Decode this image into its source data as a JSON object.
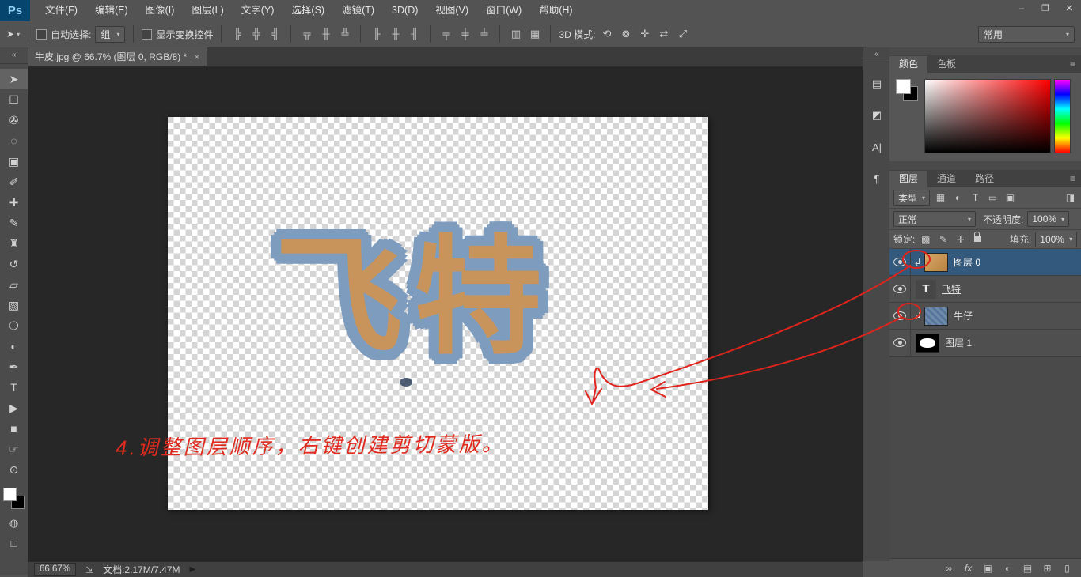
{
  "colors": {
    "selected_layer_blue": "#33597c",
    "denim_outline": "#7e9cbd",
    "leather_fill": "#c9945c",
    "annotation_red": "#e02a1e"
  },
  "window": {
    "minimize": "–",
    "restore": "❐",
    "close": "✕"
  },
  "menu_bar": {
    "logo": "Ps",
    "items": [
      "文件(F)",
      "编辑(E)",
      "图像(I)",
      "图层(L)",
      "文字(Y)",
      "选择(S)",
      "滤镜(T)",
      "3D(D)",
      "视图(V)",
      "窗口(W)",
      "帮助(H)"
    ]
  },
  "options_bar": {
    "tool_icon": "➤",
    "tool_dd": "▾",
    "auto_select_label": "自动选择:",
    "auto_select_value": "组",
    "dd_arrow": "▾",
    "show_transform_label": "显示变换控件",
    "align_icons": [
      "╠",
      "╬",
      "╣",
      "╦",
      "╫",
      "╩",
      "╟",
      "╫",
      "╢",
      "╤",
      "╪",
      "╧"
    ],
    "pair_icons": [
      "▥",
      "▦"
    ],
    "mode3d_label": "3D 模式:",
    "mode3d_icons": [
      "⟲",
      "⊚",
      "✛",
      "⇄",
      "⤢"
    ],
    "workspace": "常用"
  },
  "tab_bar": {
    "title": "牛皮.jpg @ 66.7% (图层 0, RGB/8) *",
    "close": "×"
  },
  "toolbar": {
    "collapse": "«",
    "tools": [
      {
        "id": "move",
        "glyph": "➤"
      },
      {
        "id": "marquee",
        "glyph": "☐"
      },
      {
        "id": "lasso",
        "glyph": "✇"
      },
      {
        "id": "quick-select",
        "glyph": "◌"
      },
      {
        "id": "crop",
        "glyph": "▣"
      },
      {
        "id": "eyedropper",
        "glyph": "✐"
      },
      {
        "id": "healing",
        "glyph": "✚"
      },
      {
        "id": "brush",
        "glyph": "✎"
      },
      {
        "id": "stamp",
        "glyph": "♜"
      },
      {
        "id": "history-brush",
        "glyph": "↺"
      },
      {
        "id": "eraser",
        "glyph": "▱"
      },
      {
        "id": "gradient",
        "glyph": "▧"
      },
      {
        "id": "blur",
        "glyph": "❍"
      },
      {
        "id": "dodge",
        "glyph": "◐"
      },
      {
        "id": "pen",
        "glyph": "✒"
      },
      {
        "id": "type",
        "glyph": "T"
      },
      {
        "id": "path-select",
        "glyph": "▶"
      },
      {
        "id": "shape",
        "glyph": "■"
      },
      {
        "id": "hand",
        "glyph": "☞"
      },
      {
        "id": "zoom",
        "glyph": "⊙"
      }
    ],
    "mask_icon": "◍",
    "screen_icon": "□"
  },
  "canvas": {
    "artwork_text": "飞特",
    "annotation": "4.调整图层顺序，右键创建剪切蒙版。"
  },
  "dock": {
    "collapse": "«",
    "icons": [
      "▤",
      "◩",
      "A|",
      "¶"
    ]
  },
  "color_panel": {
    "tabs": [
      "颜色",
      "色板"
    ],
    "menu_icon": "≡"
  },
  "layers_panel": {
    "tabs": [
      "图层",
      "通道",
      "路径"
    ],
    "menu_icon": "≡",
    "filter_label": "类型",
    "filter_icons": [
      "▦",
      "◐",
      "T",
      "▭",
      "▣"
    ],
    "filter_toggle": "◨",
    "blend_mode": "正常",
    "opacity_label": "不透明度:",
    "opacity_value": "100%",
    "lock_label": "锁定:",
    "lock_icons": [
      "▩",
      "✎",
      "✛"
    ],
    "fill_label": "填充:",
    "fill_value": "100%",
    "clip_arrow": "↲",
    "rows": [
      {
        "name": "图层 0",
        "clipped": true,
        "selected": true,
        "kind": "image"
      },
      {
        "name": "飞特",
        "clipped": false,
        "selected": false,
        "kind": "text",
        "thumb_glyph": "T"
      },
      {
        "name": "牛仔",
        "clipped": true,
        "selected": false,
        "kind": "denim"
      },
      {
        "name": "图层 1",
        "clipped": false,
        "selected": false,
        "kind": "mask"
      }
    ],
    "bottom_icons": [
      "∞",
      "fx",
      "▣",
      "◐",
      "▤",
      "⊞",
      "▯"
    ]
  },
  "status_bar": {
    "zoom": "66.67%",
    "flyout_icon": "⇲",
    "doc_label": "文档:2.17M/7.47M",
    "play_icon": "▶"
  }
}
